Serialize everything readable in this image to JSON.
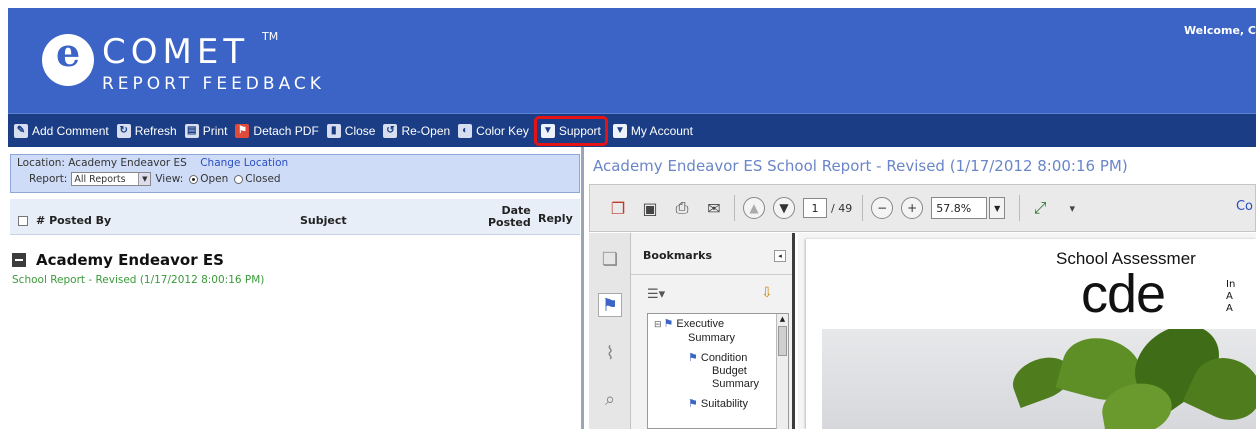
{
  "header": {
    "logo_e": "e",
    "logo_name": "COMET",
    "logo_tm": "TM",
    "logo_subtitle": "REPORT FEEDBACK",
    "welcome": "Welcome, C"
  },
  "toolbar": {
    "items": [
      {
        "label": "Add Comment"
      },
      {
        "label": "Refresh"
      },
      {
        "label": "Print"
      },
      {
        "label": "Detach PDF"
      },
      {
        "label": "Close"
      },
      {
        "label": "Re-Open"
      },
      {
        "label": "Color Key"
      },
      {
        "label": "Support",
        "highlighted": true
      },
      {
        "label": "My Account"
      }
    ]
  },
  "left_panel": {
    "location_label": "Location:",
    "location_value": "Academy Endeavor ES",
    "change_location": "Change Location",
    "report_label": "Report:",
    "report_selected": "All Reports",
    "view_label": "View:",
    "view_open": "Open",
    "view_closed": "Closed",
    "view_selected": "Open",
    "columns": {
      "num": "#",
      "posted_by": "Posted By",
      "subject": "Subject",
      "date_line1": "Date",
      "date_line2": "Posted",
      "reply": "Reply"
    },
    "group_title": "Academy Endeavor ES",
    "group_report": "School Report - Revised (1/17/2012 8:00:16 PM)"
  },
  "right_panel": {
    "title": "Academy Endeavor ES School Report - Revised (1/17/2012 8:00:16 PM)",
    "pdf_toolbar": {
      "page_current": "1",
      "page_total": "/ 49",
      "zoom": "57.8%",
      "right_text": "Co"
    },
    "bookmarks": {
      "title": "Bookmarks",
      "nodes": [
        {
          "text": "Executive",
          "indent": 0,
          "toggle": "⊟"
        },
        {
          "text": "Summary",
          "indent": 0
        },
        {
          "text": "Condition",
          "indent": 1
        },
        {
          "text": "Budget",
          "indent": 1
        },
        {
          "text": "Summary",
          "indent": 1
        },
        {
          "text": "Suitability",
          "indent": 1
        }
      ]
    },
    "document": {
      "title": "School Assessmer",
      "logo_text": "cde",
      "side_lines": [
        "In",
        "A",
        "A"
      ]
    }
  },
  "colors": {
    "header_blue": "#3b64c6",
    "toolbar_navy": "#1a3d85",
    "highlight_red": "#e51414",
    "link_blue": "#2a4fbf",
    "report_green": "#3a9a3a"
  }
}
